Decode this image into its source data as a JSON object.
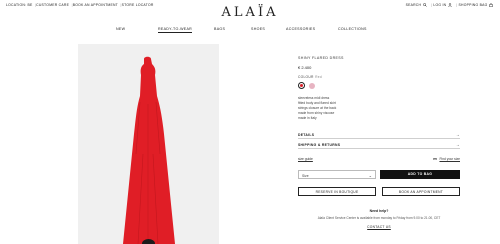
{
  "topbar": {
    "location": "LOCATION: BE",
    "customer_care": "CUSTOMER CARE",
    "appointment": "BOOK AN APPOINTMENT",
    "store_locator": "STORE LOCATOR",
    "search": "SEARCH",
    "login": "LOG IN",
    "bag": "SHOPPING BAG"
  },
  "logo": "ALAÏA",
  "nav": [
    "NEW",
    "READY-TO-WEAR",
    "BAGS",
    "SHOES",
    "ACCESSORIES",
    "COLLECTIONS"
  ],
  "nav_active": "READY-TO-WEAR",
  "product": {
    "name": "SHINY FLARED DRESS",
    "price": "€ 2.400",
    "color_label": "COLOUR",
    "color_value": "Red",
    "swatches": [
      "#d8202a",
      "#e7b4c2"
    ],
    "description": [
      "sleeveless midi dress",
      "fitted body and flared skirt",
      "strings closure at the back",
      "made from shiny viscose",
      "made in Italy"
    ],
    "dress_color": "#e01e26"
  },
  "rows": {
    "details": "DETAILS",
    "shipping": "SHIPPING & RETURNS",
    "arrow": "→"
  },
  "size": {
    "guide": "size guide",
    "find": "Find your size",
    "select_label": "Size",
    "chevron": "⌄",
    "add_to_bag": "ADD TO BAG"
  },
  "actions": {
    "reserve": "RESERVE IN BOUTIQUE",
    "appointment": "BOOK AN APPOINTMENT"
  },
  "help": {
    "question": "Need help?",
    "sub": "Alaïa Client Service Center is available from monday to Friday from 9.00 to 21.00, CET",
    "contact": "CONTACT US"
  }
}
